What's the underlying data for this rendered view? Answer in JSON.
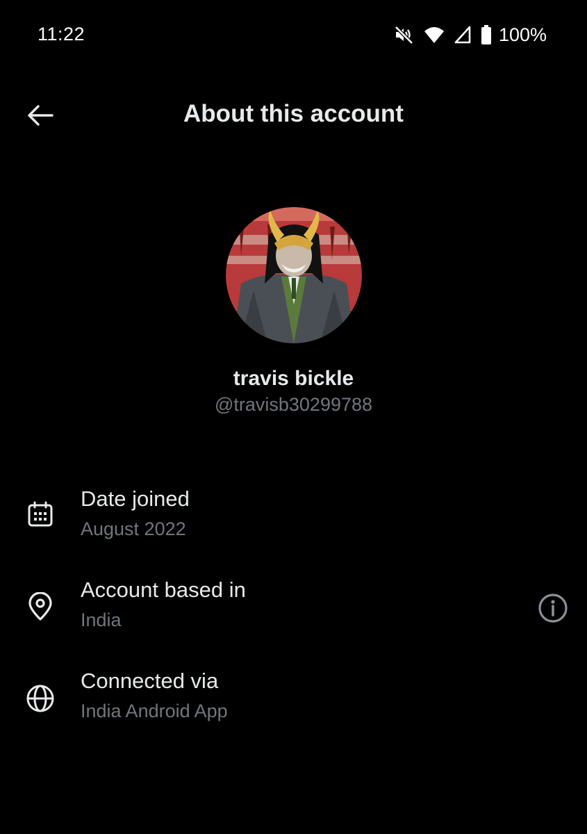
{
  "status_bar": {
    "time": "11:22",
    "battery_percent": "100%",
    "icons": [
      "mute-vibrate-icon",
      "wifi-icon",
      "signal-icon",
      "battery-icon"
    ]
  },
  "header": {
    "back_icon": "arrow-left-icon",
    "title": "About this account"
  },
  "profile": {
    "display_name": "travis bickle",
    "handle": "@travisb30299788"
  },
  "details": [
    {
      "icon": "calendar-icon",
      "label": "Date joined",
      "value": "August 2022"
    },
    {
      "icon": "location-pin-icon",
      "label": "Account based in",
      "value": "India",
      "info_icon": "info-circle-icon"
    },
    {
      "icon": "globe-icon",
      "label": "Connected via",
      "value": "India Android App"
    }
  ],
  "colors": {
    "background": "#000000",
    "primary_text": "#e7e9ea",
    "secondary_text": "#71767b"
  }
}
